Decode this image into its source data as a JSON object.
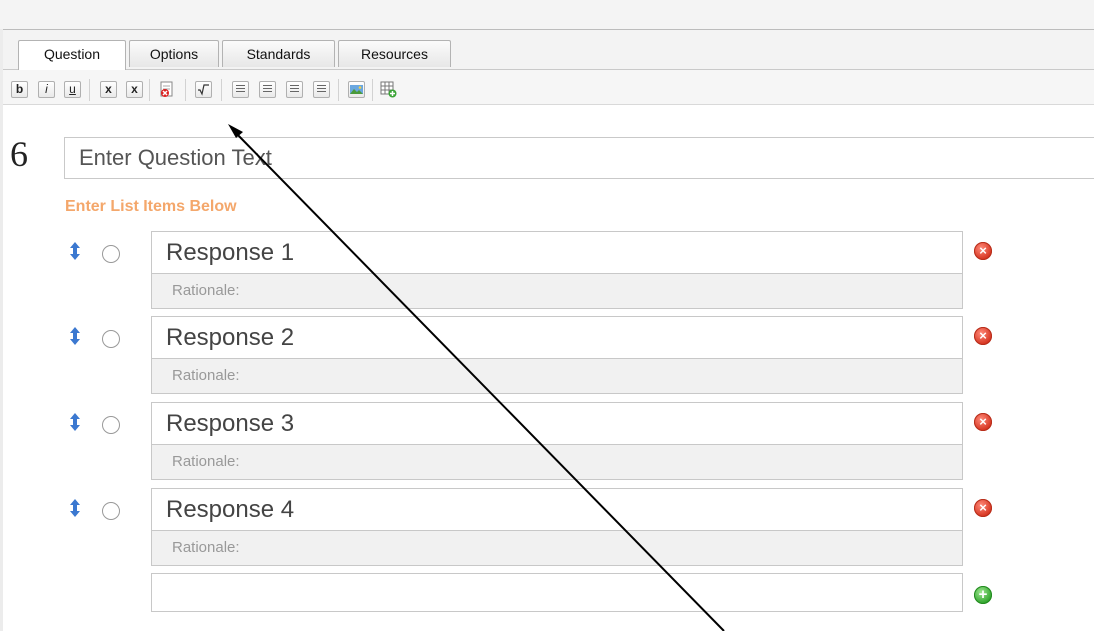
{
  "tabs": [
    {
      "label": "Question"
    },
    {
      "label": "Options"
    },
    {
      "label": "Standards"
    },
    {
      "label": "Resources"
    }
  ],
  "toolbar": {
    "bold": "b",
    "italic": "i",
    "underline": "u",
    "subscript": "x",
    "superscript": "x"
  },
  "question": {
    "number": "6",
    "text": "Enter Question Text"
  },
  "list_header": "Enter List Items Below",
  "responses": [
    {
      "text": "Response 1",
      "rationale": "Rationale:"
    },
    {
      "text": "Response 2",
      "rationale": "Rationale:"
    },
    {
      "text": "Response 3",
      "rationale": "Rationale:"
    },
    {
      "text": "Response 4",
      "rationale": "Rationale:"
    }
  ],
  "colors": {
    "list_header": "#f4a76b",
    "delete": "#d5331f",
    "add": "#2fa32b",
    "mover": "#3b78d0"
  }
}
